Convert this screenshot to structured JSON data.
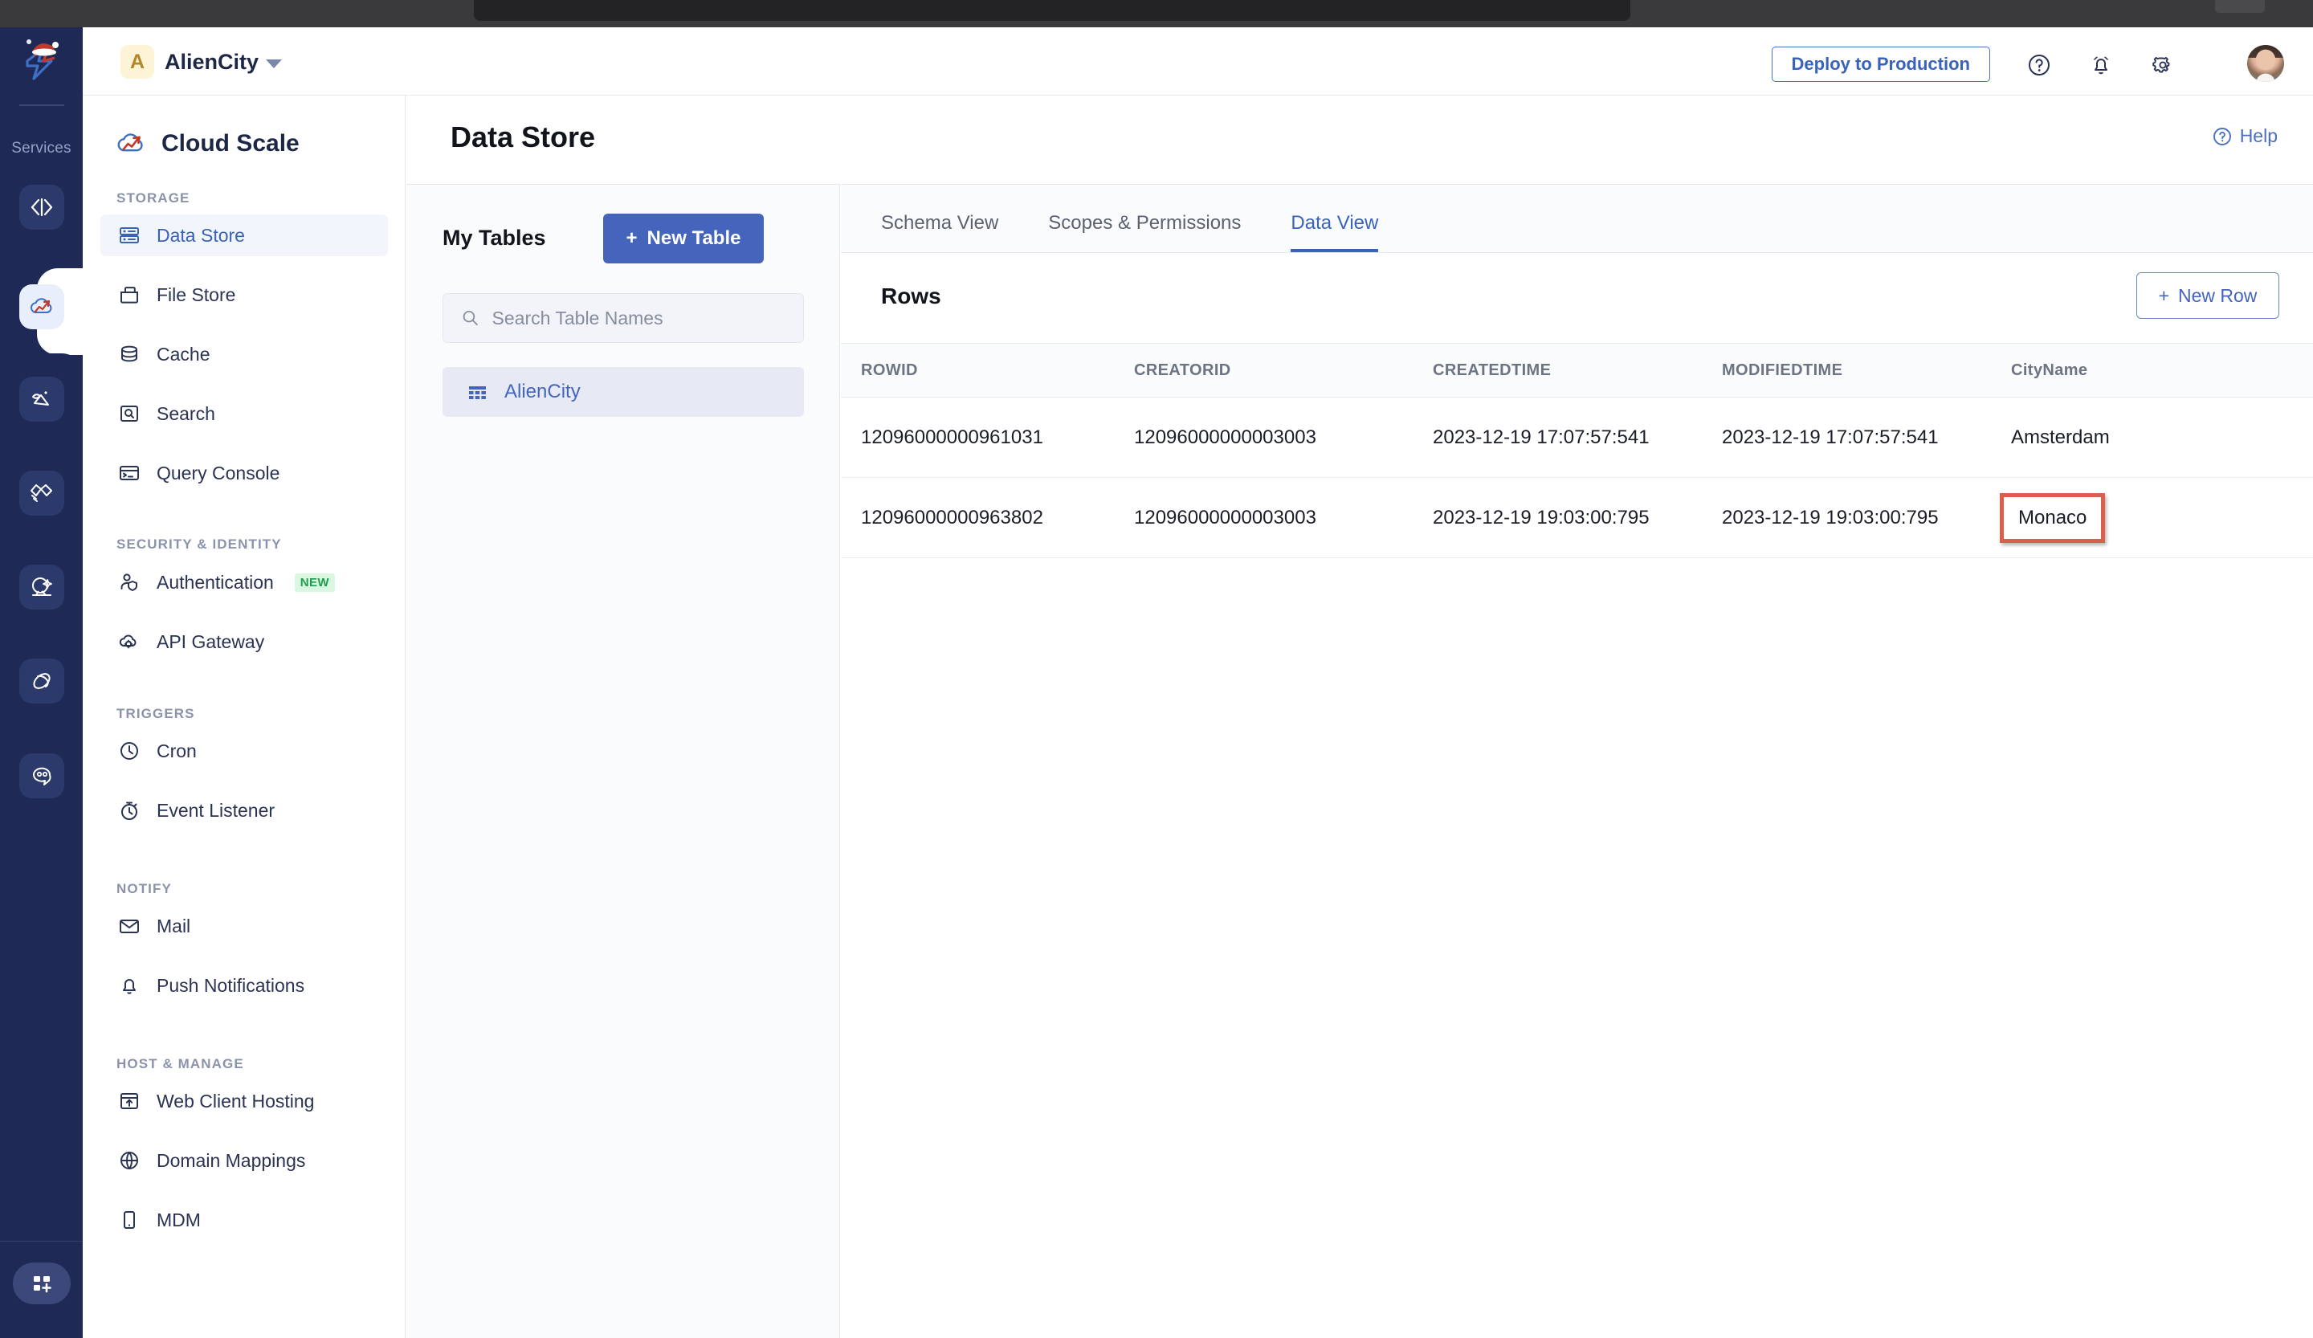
{
  "window": {
    "chrome_color": "#3a3a3c"
  },
  "rail": {
    "services_label": "Services",
    "items": [
      {
        "name": "code-icon",
        "active": false
      },
      {
        "name": "cloud-scale-icon",
        "active": true
      },
      {
        "name": "catalyst-analytics-icon",
        "active": false
      },
      {
        "name": "handshake-icon",
        "active": false
      },
      {
        "name": "ai-sphere-icon",
        "active": false
      },
      {
        "name": "orbit-icon",
        "active": false
      },
      {
        "name": "chat-bot-icon",
        "active": false
      }
    ],
    "bottom_item": "apps-grid-add-icon"
  },
  "topbar": {
    "org_initial": "A",
    "org_name": "AlienCity",
    "deploy_label": "Deploy to Production",
    "icons": [
      "help-circle-icon",
      "bell-icon",
      "gear-icon"
    ],
    "avatar": "user-avatar"
  },
  "sidebar": {
    "title": "Cloud Scale",
    "sections": [
      {
        "label": "STORAGE",
        "items": [
          {
            "label": "Data Store",
            "icon": "server-rows-icon",
            "active": true
          },
          {
            "label": "File Store",
            "icon": "folder-icon",
            "active": false
          },
          {
            "label": "Cache",
            "icon": "database-icon",
            "active": false
          },
          {
            "label": "Search",
            "icon": "search-box-icon",
            "active": false
          },
          {
            "label": "Query Console",
            "icon": "terminal-icon",
            "active": false
          }
        ]
      },
      {
        "label": "SECURITY & IDENTITY",
        "items": [
          {
            "label": "Authentication",
            "icon": "user-shield-icon",
            "active": false,
            "badge": "NEW"
          },
          {
            "label": "API Gateway",
            "icon": "cloud-gear-icon",
            "active": false
          }
        ]
      },
      {
        "label": "TRIGGERS",
        "items": [
          {
            "label": "Cron",
            "icon": "clock-icon",
            "active": false
          },
          {
            "label": "Event Listener",
            "icon": "stopwatch-icon",
            "active": false
          }
        ]
      },
      {
        "label": "NOTIFY",
        "items": [
          {
            "label": "Mail",
            "icon": "envelope-icon",
            "active": false
          },
          {
            "label": "Push Notifications",
            "icon": "bell-icon",
            "active": false
          }
        ]
      },
      {
        "label": "HOST & MANAGE",
        "items": [
          {
            "label": "Web Client Hosting",
            "icon": "upload-window-icon",
            "active": false
          },
          {
            "label": "Domain Mappings",
            "icon": "globe-icon",
            "active": false
          },
          {
            "label": "MDM",
            "icon": "mobile-device-icon",
            "active": false
          }
        ]
      }
    ]
  },
  "page": {
    "title": "Data Store",
    "help_label": "Help"
  },
  "tables_panel": {
    "heading": "My Tables",
    "new_table_label": "New Table",
    "search_placeholder": "Search Table Names",
    "search_value": "",
    "tables": [
      {
        "name": "AlienCity",
        "icon": "table-grid-icon",
        "active": true
      }
    ]
  },
  "tabs": [
    {
      "label": "Schema View",
      "active": false
    },
    {
      "label": "Scopes & Permissions",
      "active": false
    },
    {
      "label": "Data View",
      "active": true
    }
  ],
  "rows_panel": {
    "heading": "Rows",
    "new_row_label": "New Row"
  },
  "grid": {
    "columns": [
      "ROWID",
      "CREATORID",
      "CREATEDTIME",
      "MODIFIEDTIME",
      "CityName"
    ],
    "rows": [
      {
        "ROWID": "12096000000961031",
        "CREATORID": "12096000000003003",
        "CREATEDTIME": "2023-12-19 17:07:57:541",
        "MODIFIEDTIME": "2023-12-19 17:07:57:541",
        "CityName": "Amsterdam",
        "highlight": false
      },
      {
        "ROWID": "12096000000963802",
        "CREATORID": "12096000000003003",
        "CREATEDTIME": "2023-12-19 19:03:00:795",
        "MODIFIEDTIME": "2023-12-19 19:03:00:795",
        "CityName": "Monaco",
        "highlight": true
      }
    ]
  },
  "colors": {
    "accent_blue": "#4465bb",
    "rail_dark": "#1e2a55",
    "highlight_red": "#d9604a",
    "badge_green": "#1f9d4d"
  }
}
